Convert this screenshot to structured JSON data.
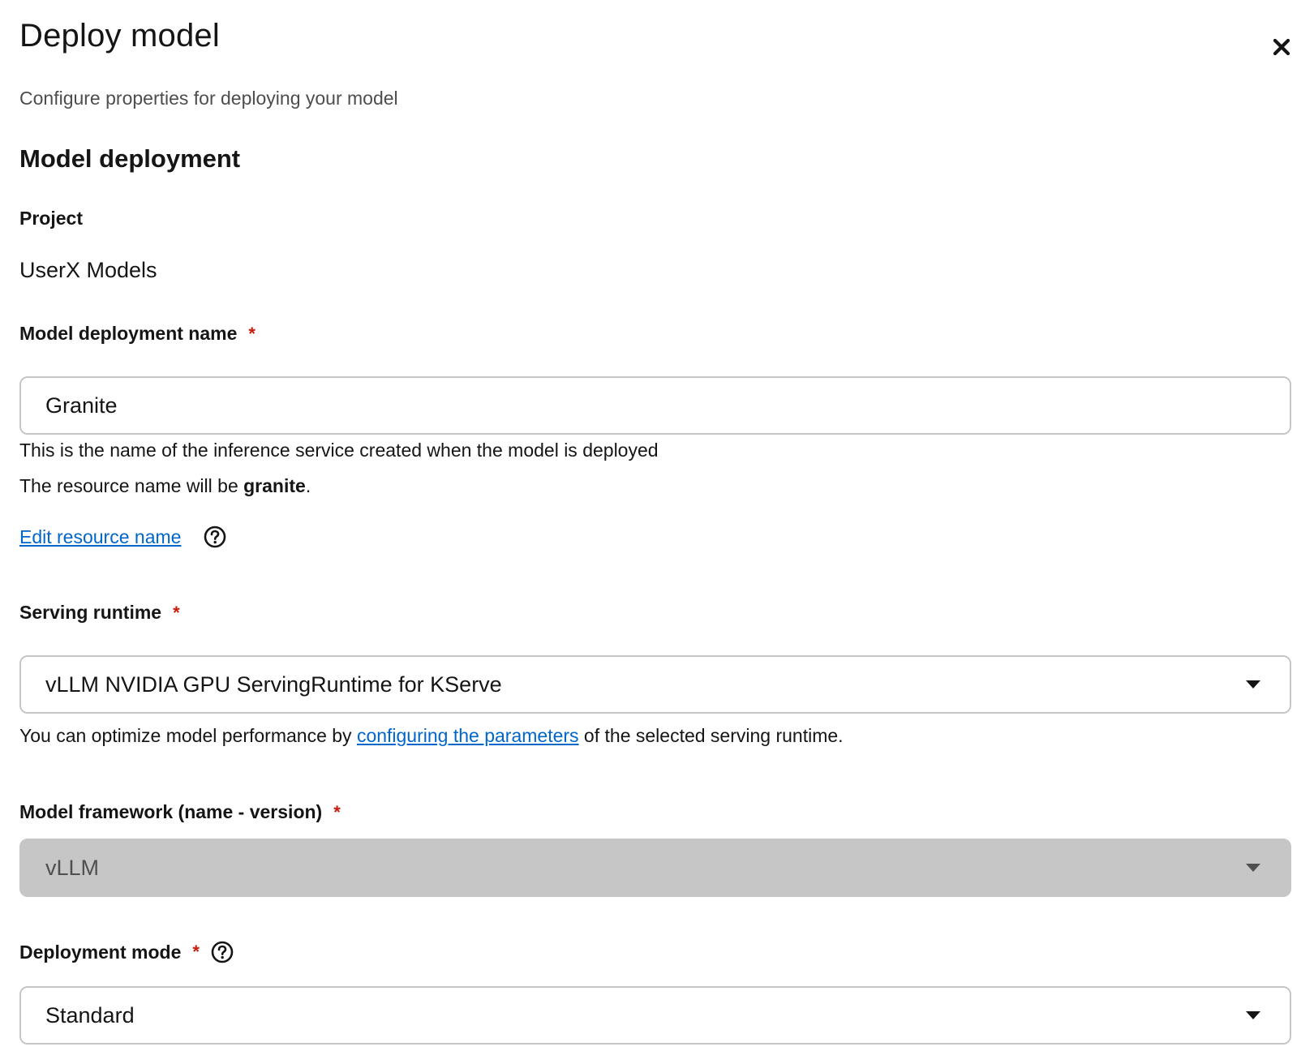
{
  "modal": {
    "title": "Deploy model",
    "subtitle": "Configure properties for deploying your model"
  },
  "section": {
    "title": "Model deployment"
  },
  "project": {
    "label": "Project",
    "value": "UserX Models"
  },
  "deployment_name": {
    "label": "Model deployment name",
    "required_mark": "*",
    "value": "Granite",
    "helper": "This is the name of the inference service created when the model is deployed",
    "resource_prefix": "The resource name will be ",
    "resource_name": "granite",
    "resource_suffix": ".",
    "edit_link": "Edit resource name"
  },
  "serving_runtime": {
    "label": "Serving runtime",
    "required_mark": "*",
    "value": "vLLM NVIDIA GPU ServingRuntime for KServe",
    "helper_prefix": "You can optimize model performance by ",
    "helper_link": "configuring the parameters",
    "helper_suffix": " of the selected serving runtime."
  },
  "model_framework": {
    "label": "Model framework (name - version)",
    "required_mark": "*",
    "value": "vLLM",
    "disabled": true
  },
  "deployment_mode": {
    "label": "Deployment mode",
    "required_mark": "*",
    "value": "Standard"
  },
  "colors": {
    "link": "#0066cc",
    "required": "#c9190b",
    "disabled_field": "#c6c6c6",
    "border": "#c7c7c7"
  },
  "icons": [
    "close-icon",
    "help-icon",
    "caret-down-icon"
  ]
}
